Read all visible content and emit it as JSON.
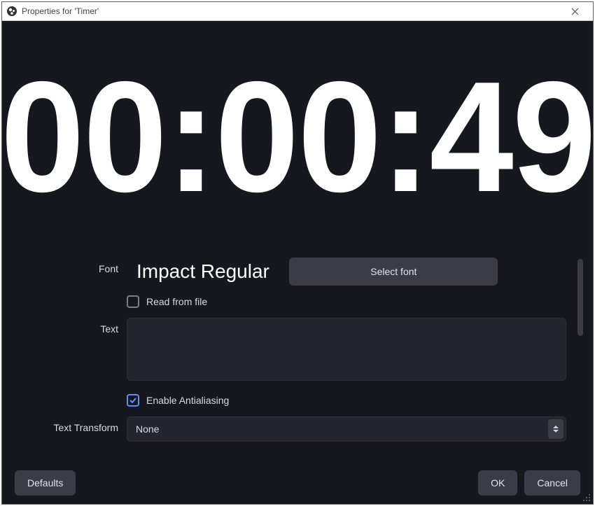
{
  "window": {
    "title": "Properties for 'Timer'"
  },
  "preview": {
    "timer_value": "00:00:49"
  },
  "form": {
    "labels": {
      "font": "Font",
      "text": "Text",
      "text_transform": "Text Transform"
    },
    "font_display": "Impact Regular",
    "select_font_btn": "Select font",
    "read_from_file_label": "Read from file",
    "read_from_file_checked": false,
    "text_value": "",
    "enable_antialias_label": "Enable Antialiasing",
    "enable_antialias_checked": true,
    "text_transform_value": "None"
  },
  "footer": {
    "defaults": "Defaults",
    "ok": "OK",
    "cancel": "Cancel"
  }
}
